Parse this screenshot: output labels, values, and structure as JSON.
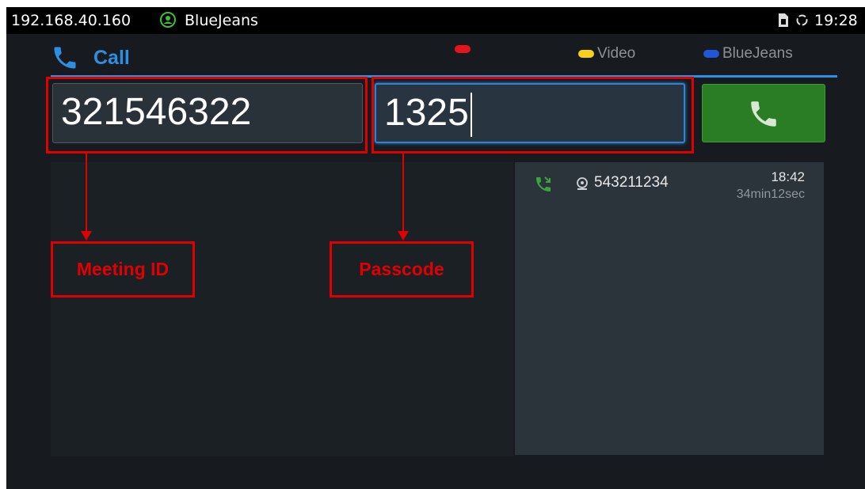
{
  "status_bar": {
    "ip": "192.168.40.160",
    "account_icon": "account-circle-icon",
    "account_name": "BlueJeans",
    "sim_icon": "sim-card-icon",
    "sync_icon": "sync-icon",
    "time": "19:28"
  },
  "header": {
    "title_icon": "phone-icon",
    "title": "Call",
    "legend": [
      {
        "label": "",
        "color": "#e8141c"
      },
      {
        "label": "Video",
        "color": "#f6d21a"
      },
      {
        "label": "BlueJeans",
        "color": "#1e57d8"
      }
    ],
    "accent_color": "#2b8fe3"
  },
  "dialer": {
    "meeting_id_value": "321546322",
    "passcode_value": "1325",
    "dial_button_icon": "phone-icon",
    "dial_button_color": "#2a7d24"
  },
  "annotations": {
    "meeting_id": "Meeting ID",
    "passcode": "Passcode",
    "color": "#e00000"
  },
  "history": [
    {
      "call_icon": "incoming-call-icon",
      "type_icon": "bluejeans-account-icon",
      "number": "543211234",
      "time": "18:42",
      "duration": "34min12sec"
    }
  ]
}
